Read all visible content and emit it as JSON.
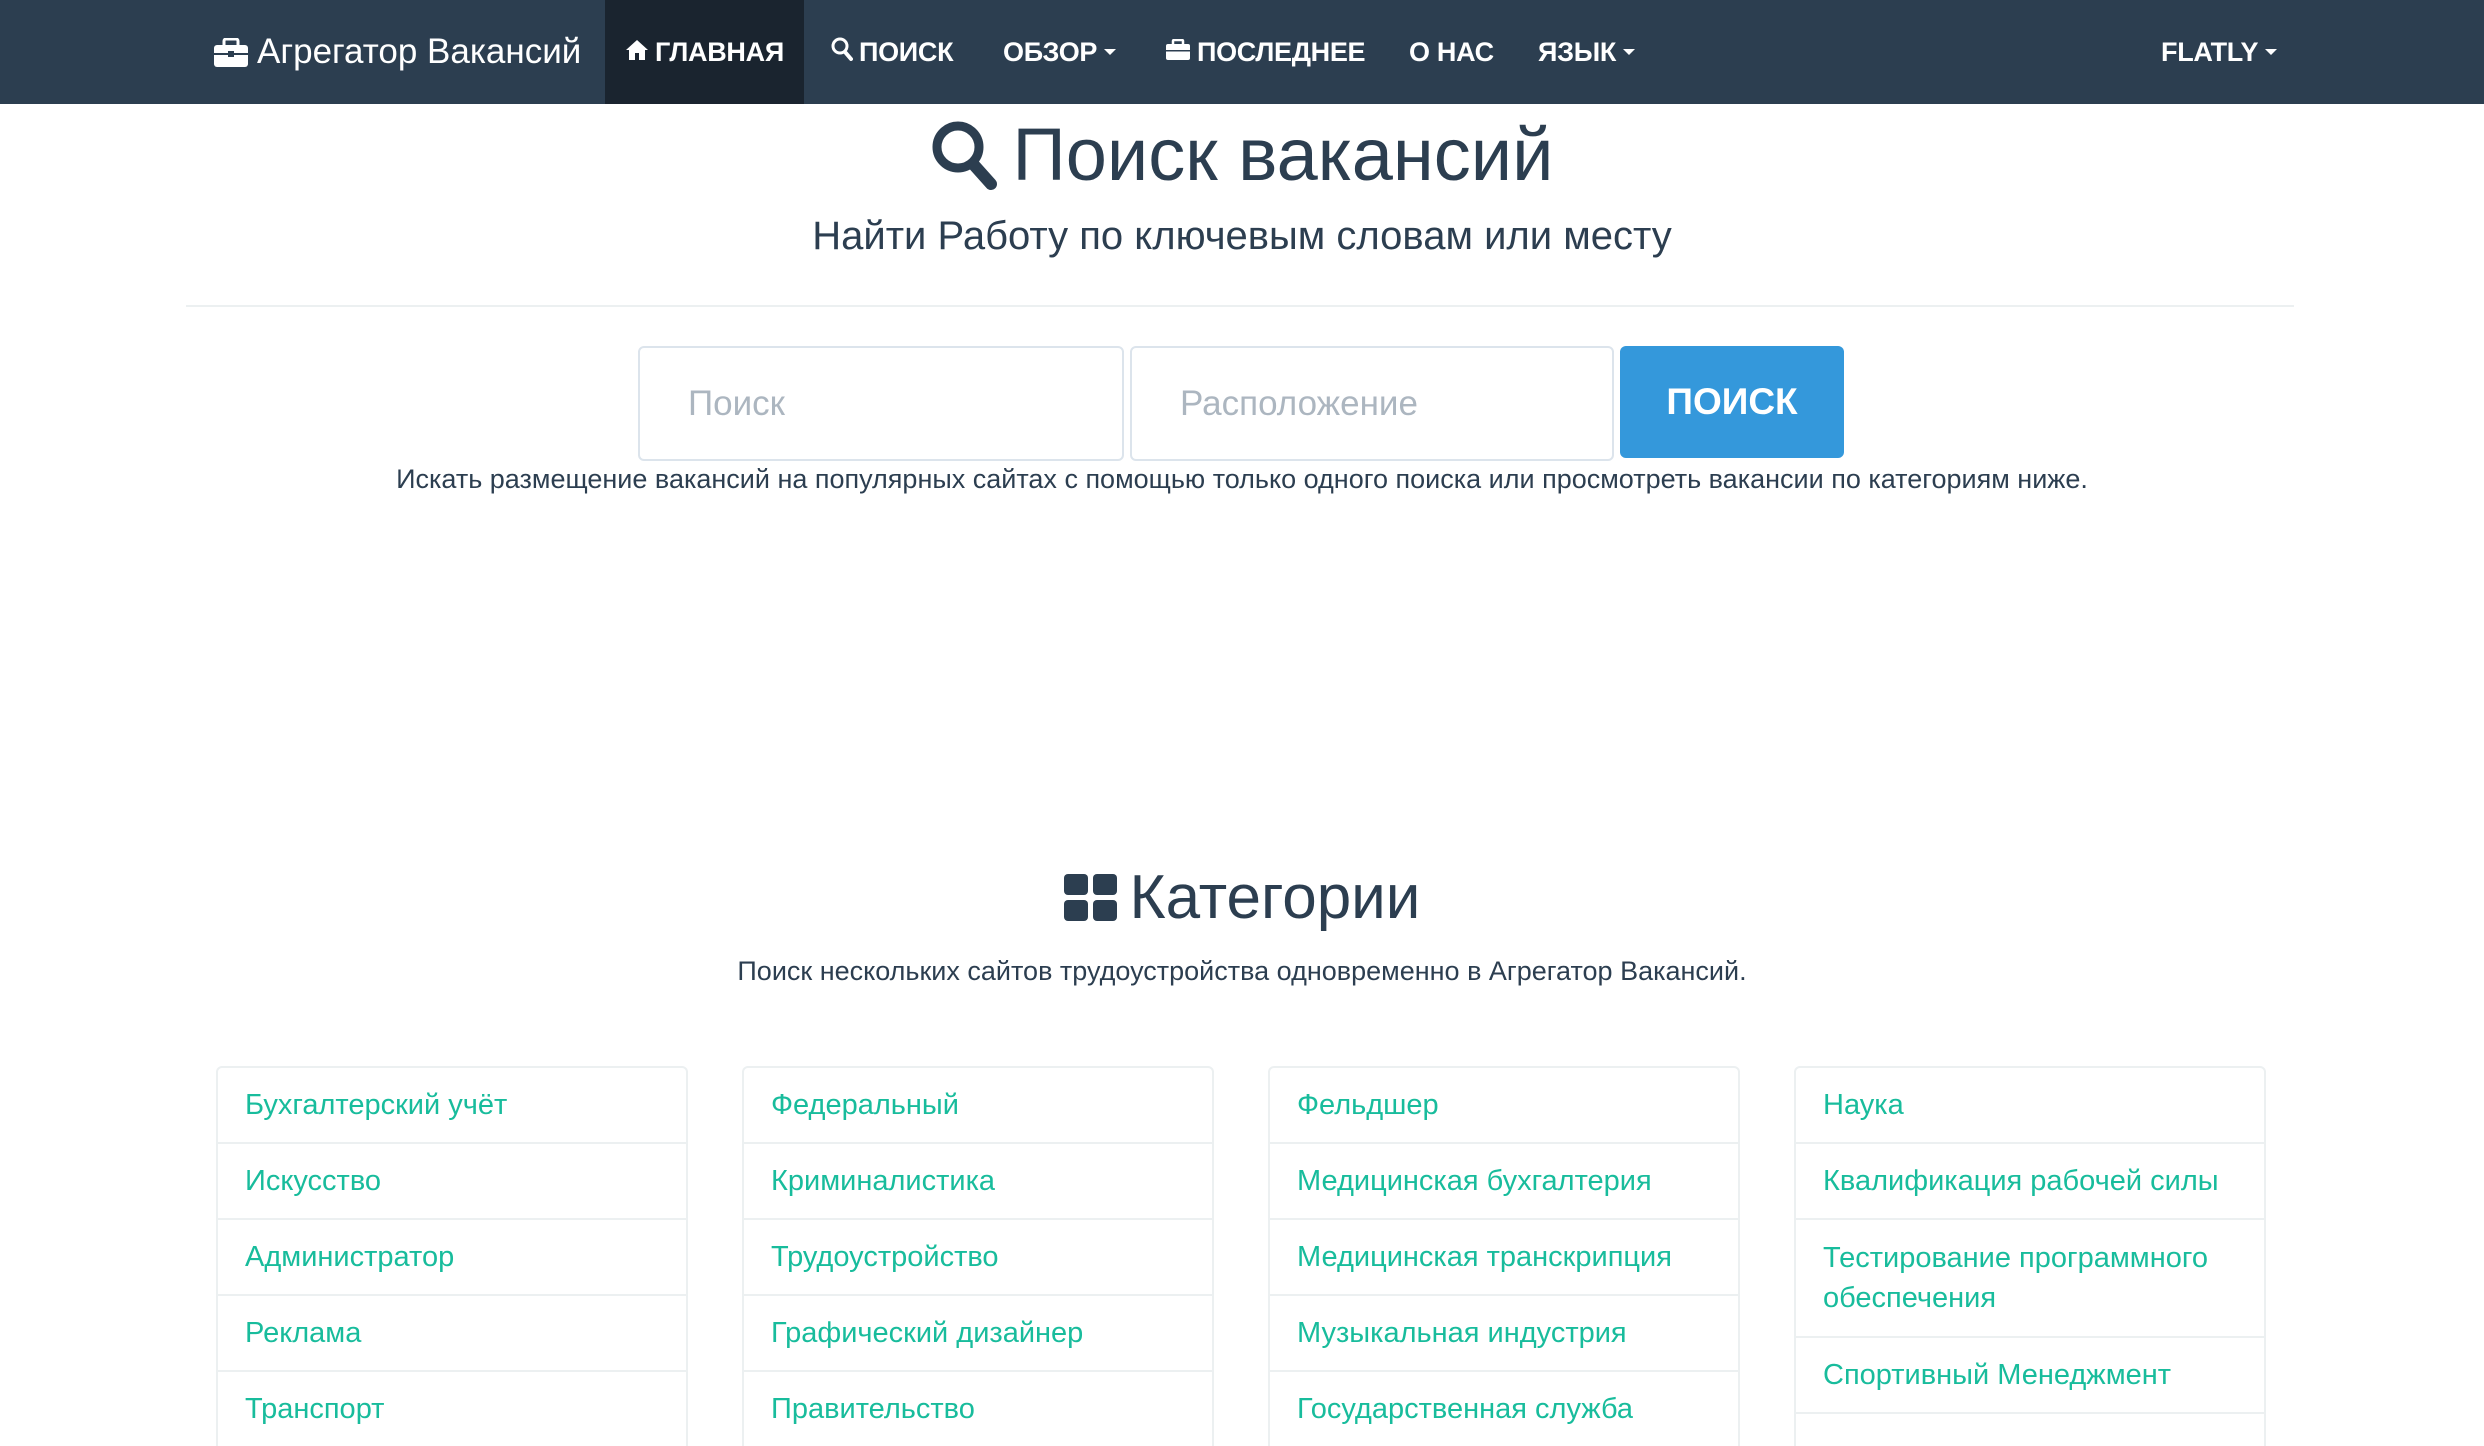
{
  "navbar": {
    "brand": "Агрегатор Вакансий",
    "items": [
      {
        "label": "ГЛАВНАЯ",
        "icon": "home-icon"
      },
      {
        "label": "ПОИСК",
        "icon": "search-icon"
      },
      {
        "label": "ОБЗОР",
        "icon": "caret-down-icon"
      },
      {
        "label": "ПОСЛЕДНЕЕ",
        "icon": "briefcase-icon"
      },
      {
        "label": "О НАС"
      },
      {
        "label": "ЯЗЫК",
        "icon": "caret-down-icon"
      }
    ],
    "theme": "FLATLY"
  },
  "hero": {
    "title": "Поиск вакансий",
    "subtitle": "Найти Работу по ключевым словам или месту"
  },
  "search": {
    "query_placeholder": "Поиск",
    "location_placeholder": "Расположение",
    "button": "ПОИСК",
    "help": "Искать размещение вакансий на популярных сайтах с помощью только одного поиска или просмотреть вакансии по категориям ниже."
  },
  "categories": {
    "title": "Категории",
    "subtitle": "Поиск нескольких сайтов трудоустройства одновременно в Агрегатор Вакансий.",
    "columns": [
      [
        "Бухгалтерский учёт",
        "Искусство",
        "Администратор",
        "Реклама",
        "Транспорт"
      ],
      [
        "Федеральный",
        "Криминалистика",
        "Трудоустройство",
        "Графический дизайнер",
        "Правительство"
      ],
      [
        "Фельдшер",
        "Медицинская бухгалтерия",
        "Медицинская транскрипция",
        "Музыкальная индустрия",
        "Государственная служба"
      ],
      [
        "Наука",
        "Квалификация рабочей силы",
        "Тестирование программного обеспечения",
        "Спортивный Менеджмент",
        ""
      ]
    ]
  },
  "colors": {
    "navbar_bg": "#2c3e50",
    "navbar_active": "#1a242f",
    "primary": "#3498db",
    "link": "#18bc9c"
  }
}
